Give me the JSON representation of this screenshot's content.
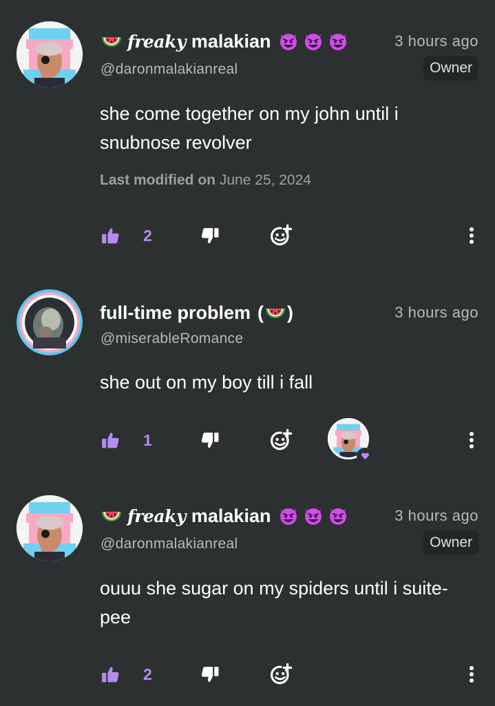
{
  "comments": [
    {
      "flair_script": "freaky",
      "display_name": "malakian",
      "handle": "@daronmalakianreal",
      "time": "3 hours ago",
      "badge": "Owner",
      "body": "she come together on my john until i snubnose revolver",
      "modified_label": "Last modified on",
      "modified_date": "June 25, 2024",
      "likes": "2",
      "icons": [
        "watermelon-icon",
        "devil-face-icon",
        "devil-face-icon",
        "devil-face-icon"
      ]
    },
    {
      "display_name": "full-time problem",
      "paren_open": "(",
      "paren_close": ")",
      "handle": "@miserableRomance",
      "time": "3 hours ago",
      "body": "she out on my boy till i fall",
      "likes": "1",
      "icons": [
        "watermelon-icon",
        "owner-liked-heart-icon"
      ]
    },
    {
      "flair_script": "freaky",
      "display_name": "malakian",
      "handle": "@daronmalakianreal",
      "time": "3 hours ago",
      "badge": "Owner",
      "body": "ouuu she sugar on my spiders until i suite-pee",
      "likes": "2",
      "icons": [
        "watermelon-icon",
        "devil-face-icon",
        "devil-face-icon",
        "devil-face-icon"
      ]
    }
  ],
  "action_icons": [
    "thumbs-up-icon",
    "thumbs-down-icon",
    "add-reaction-icon",
    "more-options-icon"
  ],
  "colors": {
    "background": "#2c3030",
    "accent_purple": "#b58cf2",
    "muted_text": "#b6bbbb",
    "badge_bg": "#222626"
  }
}
